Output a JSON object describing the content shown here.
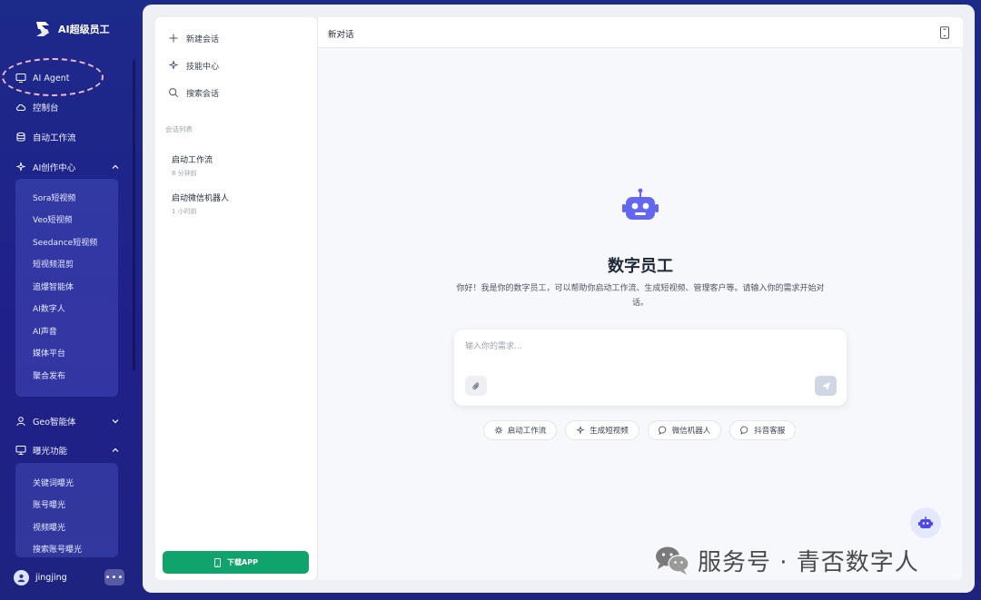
{
  "app": {
    "name": "AI超级员工"
  },
  "sidebar": {
    "items": [
      {
        "label": "AI Agent",
        "icon": "monitor-icon"
      },
      {
        "label": "控制台",
        "icon": "cloud-icon"
      },
      {
        "label": "自动工作流",
        "icon": "workflow-icon"
      },
      {
        "label": "AI创作中心",
        "icon": "sparkle-icon",
        "expanded": true
      },
      {
        "label": "Geo智能体",
        "icon": "user-icon",
        "expanded": false
      },
      {
        "label": "曝光功能",
        "icon": "display-icon",
        "expanded": true
      }
    ],
    "ai_creation_sub": [
      "Sora短视频",
      "Veo短视频",
      "Seedance短视频",
      "短视频混剪",
      "追爆智能体",
      "AI数字人",
      "AI声音",
      "媒体平台",
      "聚合发布"
    ],
    "exposure_sub": [
      "关键词曝光",
      "账号曝光",
      "视频曝光",
      "搜索账号曝光"
    ],
    "user": {
      "name": "jingjing",
      "more": "•••"
    }
  },
  "conversations": {
    "actions": [
      {
        "label": "新建会话",
        "icon": "plus-icon"
      },
      {
        "label": "技能中心",
        "icon": "sparkle-icon"
      },
      {
        "label": "搜索会话",
        "icon": "search-icon"
      }
    ],
    "section_title": "会话列表",
    "list": [
      {
        "title": "启动工作流",
        "time": "8 分钟前"
      },
      {
        "title": "启动微信机器人",
        "time": "1 小时前"
      }
    ],
    "download_label": "下载APP"
  },
  "chat": {
    "title": "新对话",
    "hero_title": "数字员工",
    "hero_desc": "你好！我是你的数字员工，可以帮助你启动工作流、生成短视频、管理客户等。请输入你的需求开始对话。",
    "input_placeholder": "输入你的需求...",
    "chips": [
      {
        "label": "启动工作流",
        "icon": "gear-icon"
      },
      {
        "label": "生成短视频",
        "icon": "sparkle-icon"
      },
      {
        "label": "微信机器人",
        "icon": "chat-icon"
      },
      {
        "label": "抖音客服",
        "icon": "chat-icon"
      }
    ]
  },
  "watermark": {
    "text": "服务号 · 青否数字人"
  },
  "colors": {
    "accent": "#6366f1",
    "download": "#10a46c",
    "sidebar_bg": "#1f248a"
  }
}
